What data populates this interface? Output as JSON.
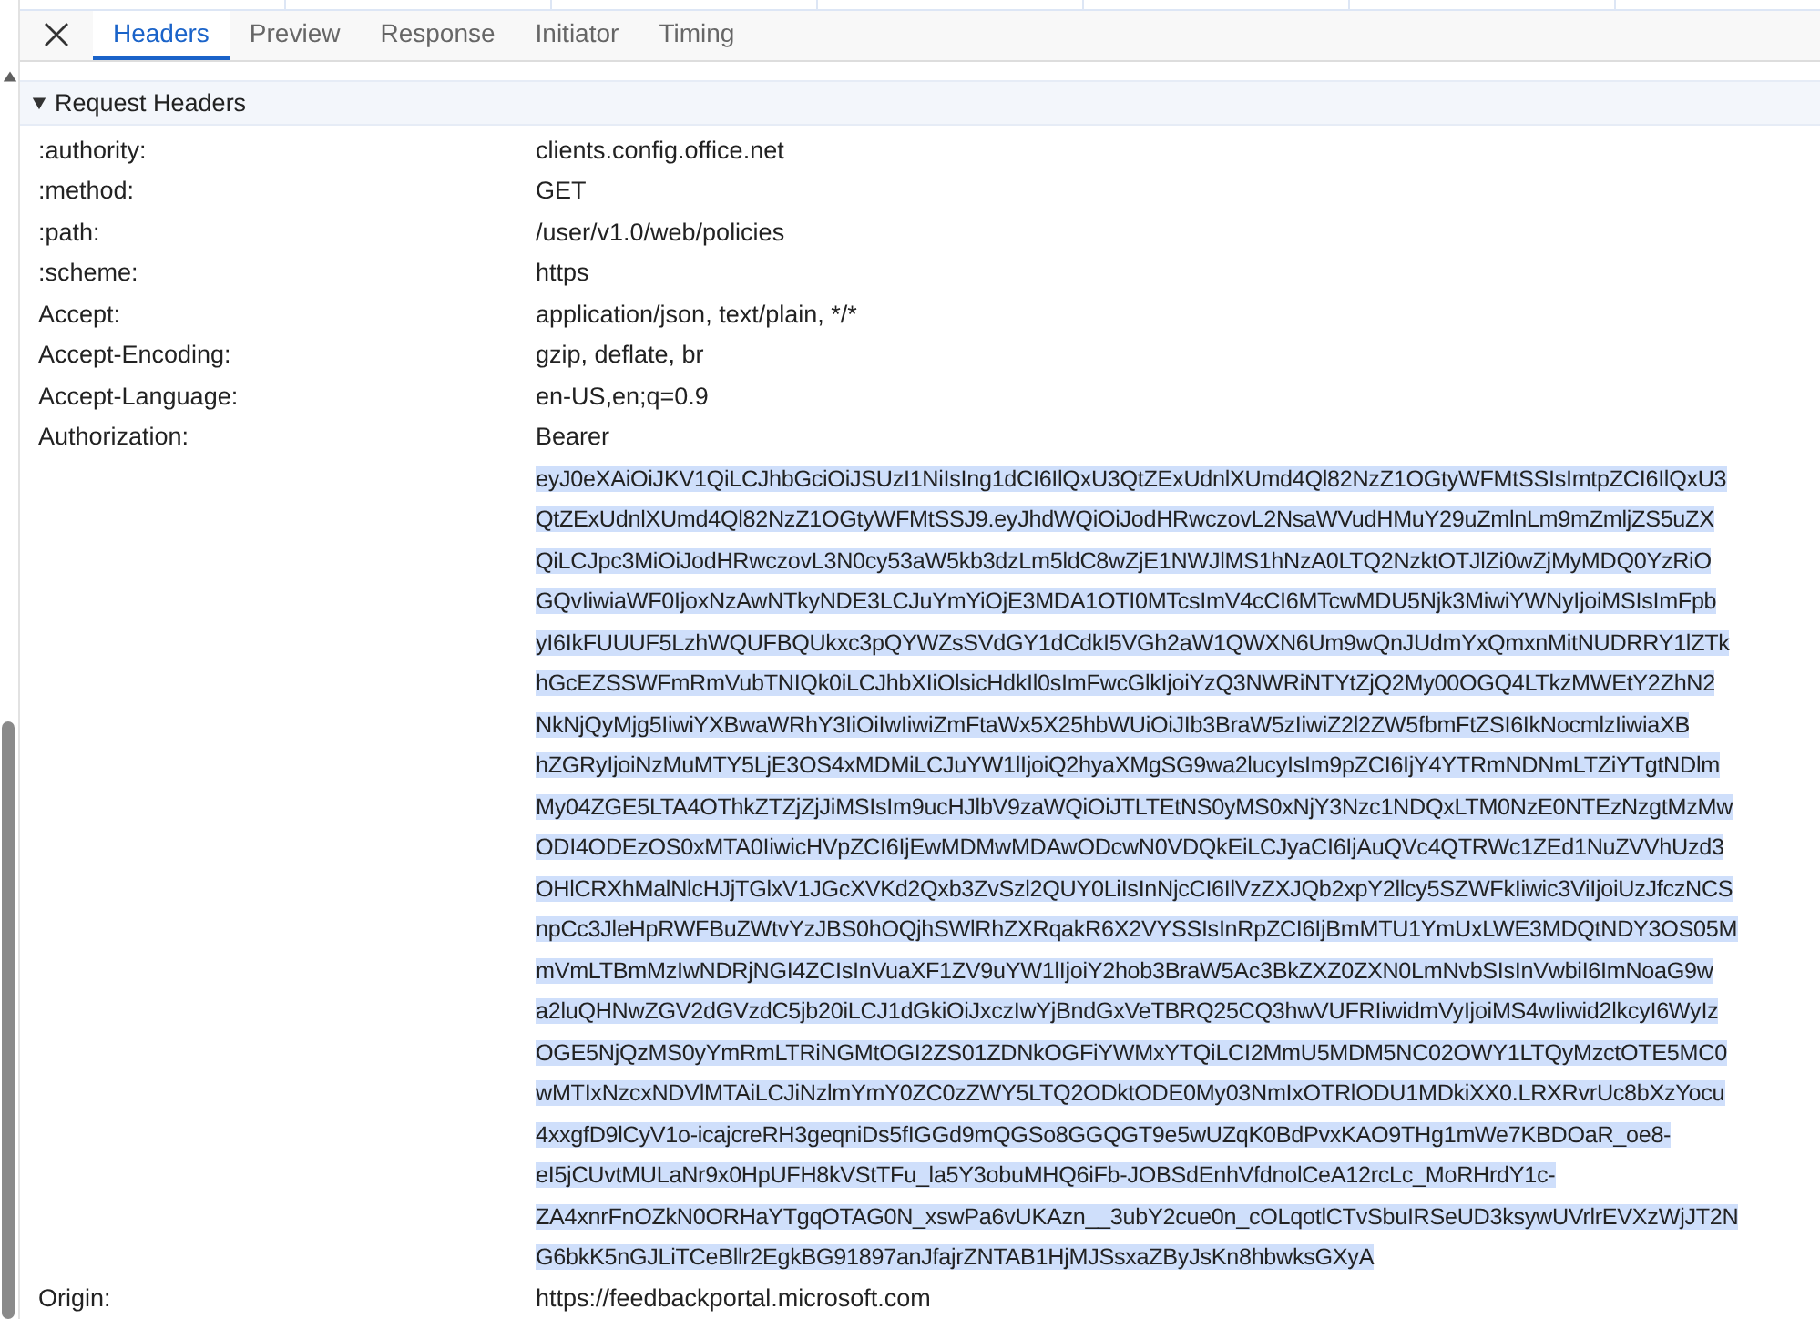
{
  "tabs": [
    {
      "label": "Headers",
      "selected": true
    },
    {
      "label": "Preview",
      "selected": false
    },
    {
      "label": "Response",
      "selected": false
    },
    {
      "label": "Initiator",
      "selected": false
    },
    {
      "label": "Timing",
      "selected": false
    }
  ],
  "section": {
    "title": "Request Headers",
    "expanded": true
  },
  "headers": [
    {
      "name": ":authority:",
      "value": "clients.config.office.net"
    },
    {
      "name": ":method:",
      "value": "GET"
    },
    {
      "name": ":path:",
      "value": "/user/v1.0/web/policies"
    },
    {
      "name": ":scheme:",
      "value": "https"
    },
    {
      "name": "Accept:",
      "value": "application/json, text/plain, */*"
    },
    {
      "name": "Accept-Encoding:",
      "value": "gzip, deflate, br"
    },
    {
      "name": "Accept-Language:",
      "value": "en-US,en;q=0.9"
    },
    {
      "name": "Authorization:",
      "value": "Bearer",
      "token": {
        "selected": true,
        "lines": [
          "eyJ0eXAiOiJKV1QiLCJhbGciOiJSUzI1NiIsIng1dCI6IlQxU3QtZExUdnlXUmd4Ql82NzZ1OGtyWFMtSSIsImtpZCI6IlQxU3",
          "QtZExUdnlXUmd4Ql82NzZ1OGtyWFMtSSJ9.eyJhdWQiOiJodHRwczovL2NsaWVudHMuY29uZmlnLm9mZmljZS5uZX",
          "QiLCJpc3MiOiJodHRwczovL3N0cy53aW5kb3dzLm5ldC8wZjE1NWJlMS1hNzA0LTQ2NzktOTJlZi0wZjMyMDQ0YzRiO",
          "GQvIiwiaWF0IjoxNzAwNTkyNDE3LCJuYmYiOjE3MDA1OTI0MTcsImV4cCI6MTcwMDU5Njk3MiwiYWNyIjoiMSIsImFpb",
          "yI6IkFUUUF5LzhWQUFBQUkxc3pQYWZsSVdGY1dCdkI5VGh2aW1QWXN6Um9wQnJUdmYxQmxnMitNUDRRY1lZTk",
          "hGcEZSSWFmRmVubTNIQk0iLCJhbXIiOlsicHdkIl0sImFwcGlkIjoiYzQ3NWRiNTYtZjQ2My00OGQ4LTkzMWEtY2ZhN2",
          "NkNjQyMjg5IiwiYXBwaWRhY3IiOiIwIiwiZmFtaWx5X25hbWUiOiJIb3BraW5zIiwiZ2l2ZW5fbmFtZSI6IkNocmlzIiwiaXB",
          "hZGRyIjoiNzMuMTY5LjE3OS4xMDMiLCJuYW1lIjoiQ2hyaXMgSG9wa2lucyIsIm9pZCI6IjY4YTRmNDNmLTZiYTgtNDlm",
          "My04ZGE5LTA4OThkZTZjZjJiMSIsIm9ucHJlbV9zaWQiOiJTLTEtNS0yMS0xNjY3Nzc1NDQxLTM0NzE0NTEzNzgtMzMw",
          "ODI4ODEzOS0xMTA0IiwicHVpZCI6IjEwMDMwMDAwODcwN0VDQkEiLCJyaCI6IjAuQVc4QTRWc1ZEd1NuZVVhUzd3",
          "OHlCRXhMalNlcHJjTGlxV1JGcXVKd2Qxb3ZvSzl2QUY0LiIsInNjcCI6IlVzZXJQb2xpY2llcy5SZWFkIiwic3ViIjoiUzJfczNCS",
          "npCc3JleHpRWFBuZWtvYzJBS0hOQjhSWlRhZXRqakR6X2VYSSIsInRpZCI6IjBmMTU1YmUxLWE3MDQtNDY3OS05M",
          "mVmLTBmMzIwNDRjNGI4ZCIsInVuaXF1ZV9uYW1lIjoiY2hob3BraW5Ac3BkZXZ0ZXN0LmNvbSIsInVwbiI6ImNoaG9w",
          "a2luQHNwZGV2dGVzdC5jb20iLCJ1dGkiOiJxczIwYjBndGxVeTBRQ25CQ3hwVUFRIiwidmVyIjoiMS4wIiwid2lkcyI6WyIz",
          "OGE5NjQzMS0yYmRmLTRiNGMtOGI2ZS01ZDNkOGFiYWMxYTQiLCI2MmU5MDM5NC02OWY1LTQyMzctOTE5MC0",
          "wMTIxNzcxNDVlMTAiLCJiNzlmYmY0ZC0zZWY5LTQ2ODktODE0My03NmIxOTRlODU1MDkiXX0.LRXRvrUc8bXzYocu",
          "4xxgfD9lCyV1o-icajcreRH3geqniDs5fIGGd9mQGSo8GGQGT9e5wUZqK0BdPvxKAO9THg1mWe7KBDOaR_oe8-",
          "eI5jCUvtMULaNr9x0HpUFH8kVStTFu_la5Y3obuMHQ6iFb-JOBSdEnhVfdnolCeA12rcLc_MoRHrdY1c-",
          "ZA4xnrFnOZkN0ORHaYTgqOTAG0N_xswPa6vUKAzn__3ubY2cue0n_cOLqotlCTvSbuIRSeUD3ksywUVrlrEVXzWjJT2N",
          "G6bkK5nGJLiTCeBllr2EgkBG91897anJfajrZNTAB1HjMJSsxaZByJsKn8hbwksGXyA"
        ]
      }
    },
    {
      "name": "Origin:",
      "value": "https://feedbackportal.microsoft.com"
    }
  ]
}
